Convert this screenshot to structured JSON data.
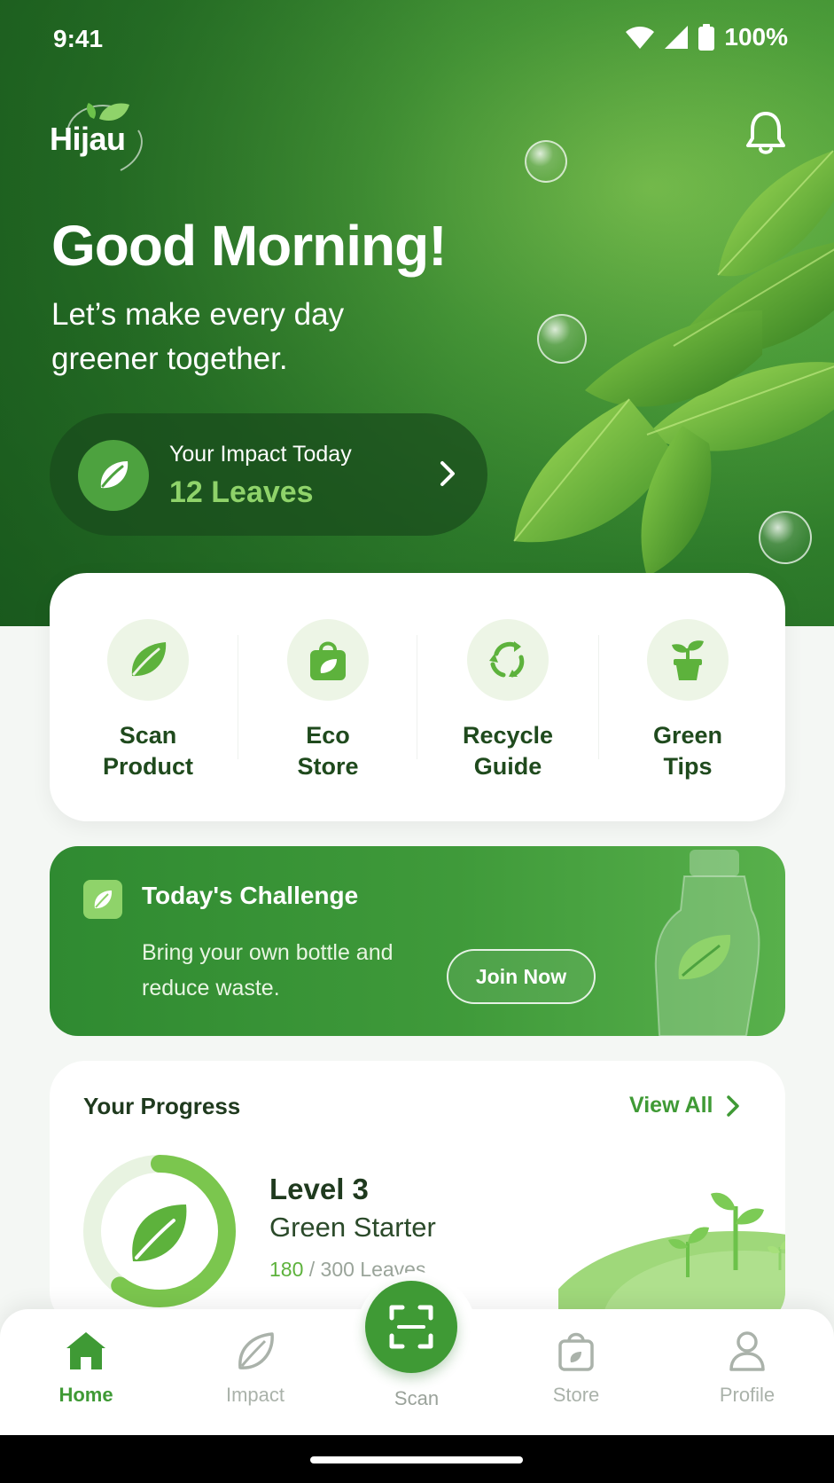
{
  "status_bar": {
    "time": "9:41",
    "battery": "100%"
  },
  "brand": {
    "name": "Hijau",
    "accent": "#3f9a35",
    "light_accent": "#8fd36a",
    "dark_green": "#1f6422"
  },
  "hero": {
    "greeting": "Good Morning!",
    "subtitle": "Let’s make every day greener together."
  },
  "impact": {
    "label": "Your Impact Today",
    "value": "12 Leaves"
  },
  "quick_actions": [
    {
      "label": "Scan\nProduct",
      "icon": "leaf-icon"
    },
    {
      "label": "Eco\nStore",
      "icon": "shopping-bag-icon"
    },
    {
      "label": "Recycle\nGuide",
      "icon": "recycle-icon"
    },
    {
      "label": "Green\nTips",
      "icon": "plant-pot-icon"
    }
  ],
  "challenge": {
    "title": "Today's Challenge",
    "text": "Bring your own bottle and reduce waste.",
    "button": "Join Now"
  },
  "progress": {
    "title": "Your Progress",
    "view_all": "View All",
    "level": "Level 3",
    "level_name": "Green Starter",
    "current": "180",
    "total": "/ 300 Leaves",
    "fraction": 0.6
  },
  "nav": {
    "items": [
      {
        "label": "Home",
        "icon": "home-icon",
        "active": true
      },
      {
        "label": "Impact",
        "icon": "leaf-outline-icon",
        "active": false
      },
      {
        "label": "Scan",
        "icon": "scan-icon",
        "active": false
      },
      {
        "label": "Store",
        "icon": "bag-icon",
        "active": false
      },
      {
        "label": "Profile",
        "icon": "user-icon",
        "active": false
      }
    ]
  }
}
